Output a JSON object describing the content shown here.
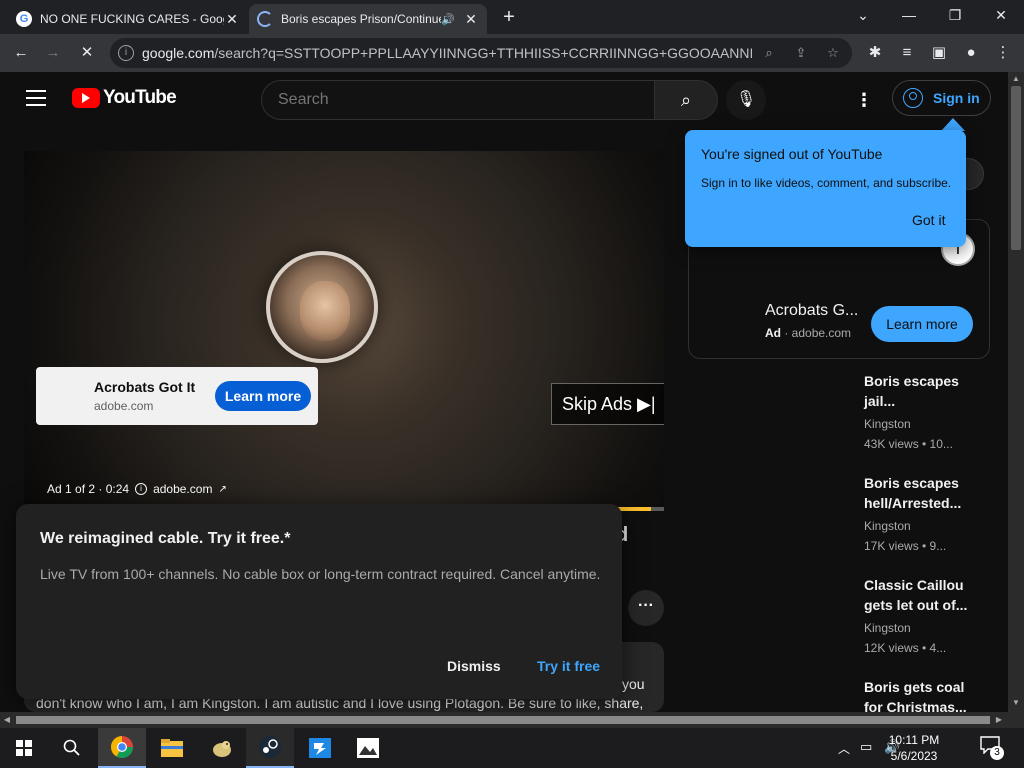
{
  "browser": {
    "tabs": [
      {
        "title": "NO ONE FUCKING CARES - Google Search",
        "close": "✕"
      },
      {
        "title": "Boris escapes Prison/Continued",
        "close": "✕"
      }
    ],
    "new_tab": "+",
    "window_controls": {
      "tabsearch": "⌄",
      "minimize": "—",
      "maximize": "❐",
      "close": "✕"
    },
    "nav": {
      "back": "←",
      "forward": "→",
      "reload": "✕"
    },
    "url_domain": "google.com",
    "url_rest": "/search?q=SSTTOOPP+PPLLAAYYIINNGG+TTHHIISS+CCRRIINNGG+GGOOAANNIIM..."
  },
  "youtube": {
    "logo_text": "YouTube",
    "search_placeholder": "Search",
    "sign_in": "Sign in",
    "tooltip": {
      "title": "You're signed out of YouTube",
      "body": "Sign in to like videos, comment, and subscribe.",
      "button": "Got it"
    },
    "video": {
      "ad_card_title": "Acrobats Got It",
      "ad_card_domain": "adobe.com",
      "ad_card_button": "Learn more",
      "skip": "Skip Ads ▶|",
      "ad_counter": "Ad 1 of 2 · 0:24",
      "ad_domain": "adobe.com",
      "ad_progress": 0.98
    },
    "promo": {
      "title": "We reimagined cable. Try it free.*",
      "body": "Live TV from 100+ channels. No cable box or long-term contract required. Cancel anytime.",
      "dismiss": "Dismiss",
      "try": "Try it free"
    },
    "title_fragment": "d",
    "more_button": "···",
    "description_tail": "you",
    "description_line": "don't know who I am, I am Kingston. I am autistic and I love using Plotagon. Be sure to like, share,",
    "side_ad": {
      "title": "Acrobats G...",
      "ad_label": "Ad",
      "domain": "adobe.com",
      "button": "Learn more",
      "info": "i"
    },
    "recommendations": [
      {
        "title1": "Boris escapes",
        "title2": "jail...",
        "channel": "Kingston",
        "meta": "43K views  • 10..."
      },
      {
        "title1": "Boris escapes",
        "title2": "hell/Arrested...",
        "channel": "Kingston",
        "meta": "17K views  • 9..."
      },
      {
        "title1": "Classic Caillou",
        "title2": "gets let out of...",
        "channel": "Kingston",
        "meta": "12K views  • 4..."
      },
      {
        "title1": "Boris gets coal",
        "title2": "for Christmas...",
        "channel": "",
        "meta": ""
      }
    ]
  },
  "taskbar": {
    "time": "10:11 PM",
    "date": "5/6/2023",
    "notification_count": "3"
  },
  "colors": {
    "yt_blue": "#3ea6ff",
    "yt_red": "#ff0000",
    "ad_yellow": "#fbc02d"
  }
}
